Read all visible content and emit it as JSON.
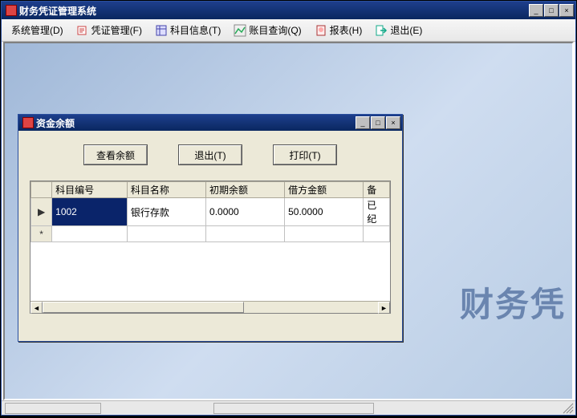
{
  "window": {
    "title": "财务凭证管理系统",
    "min": "_",
    "max": "□",
    "close": "×"
  },
  "menu": {
    "system": "系统管理(D)",
    "voucher": "凭证管理(F)",
    "subject": "科目信息(T)",
    "ledger": "账目查询(Q)",
    "report": "报表(H)",
    "exit": "退出(E)"
  },
  "watermark": "财务凭",
  "dialog": {
    "title": "资金余额",
    "buttons": {
      "view": "查看余额",
      "exit": "退出(T)",
      "print": "打印(T)"
    },
    "grid": {
      "headers": {
        "code": "科目编号",
        "name": "科目名称",
        "opening": "初期余额",
        "debit": "借方金额",
        "tail": "备"
      },
      "rows": [
        {
          "marker": "▶",
          "code": "1002",
          "name": "银行存款",
          "opening": "0.0000",
          "debit": "50.0000",
          "tail": "已纪"
        },
        {
          "marker": "*",
          "code": "",
          "name": "",
          "opening": "",
          "debit": "",
          "tail": ""
        }
      ]
    }
  },
  "scroll": {
    "left": "◄",
    "right": "►"
  }
}
